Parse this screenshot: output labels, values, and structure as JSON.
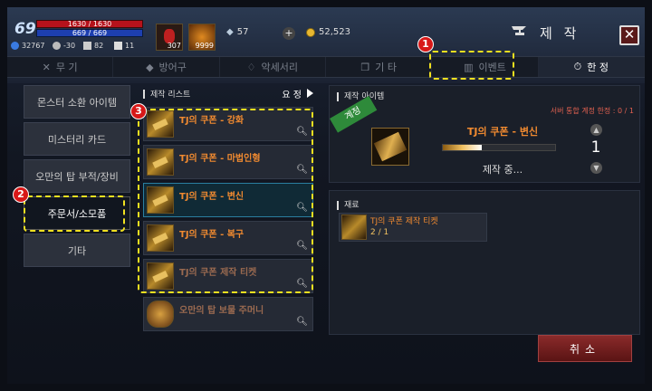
{
  "player": {
    "level": "69",
    "hp": "1630 / 1630",
    "mp": "669 / 669",
    "stats": [
      {
        "icon": "cloud-icon",
        "value": "32767"
      },
      {
        "icon": "skull-icon",
        "value": "-30"
      },
      {
        "icon": "bird-icon",
        "value": "82"
      },
      {
        "icon": "claw-icon",
        "value": "11"
      }
    ]
  },
  "slots": [
    {
      "icon": "potion-icon",
      "count": "307"
    },
    {
      "icon": "fire-orb-icon",
      "count": "9999"
    }
  ],
  "gem": "57",
  "gold": "52,523",
  "header": {
    "title": "제 작"
  },
  "tabs": [
    {
      "label": "무 기",
      "icon": "✕"
    },
    {
      "label": "방어구",
      "icon": "◆"
    },
    {
      "label": "악세서리",
      "icon": "♢"
    },
    {
      "label": "기 타",
      "icon": "❒"
    },
    {
      "label": "이벤트",
      "icon": "▥"
    },
    {
      "label": "한 정",
      "icon": "⏱"
    }
  ],
  "left_menu": [
    "몬스터 소환 아이템",
    "미스터리 카드",
    "오만의 탑 부적/장비",
    "주문서/소모품",
    "기타"
  ],
  "list": {
    "title": "제작 리스트",
    "sort": "요 정",
    "items": [
      "TJ의 쿠폰 - 강화",
      "TJ의 쿠폰 - 마법인형",
      "TJ의 쿠폰 - 변신",
      "TJ의 쿠폰 - 복구",
      "TJ의 쿠폰 제작 티켓",
      "오만의 탑 보물 주머니"
    ]
  },
  "detail": {
    "title": "제작 아이템",
    "limit": "서버 통합 계정 한정 : 0 / 1",
    "ribbon": "계정",
    "name": "TJ의 쿠폰 - 변신",
    "status": "제작 중...",
    "qty": "1",
    "progress": 0.35
  },
  "materials": {
    "title": "재료",
    "name": "TJ의 쿠폰 제작 티켓",
    "qty": "2 / 1"
  },
  "cancel": "취소",
  "callouts": [
    "1",
    "2",
    "3"
  ]
}
